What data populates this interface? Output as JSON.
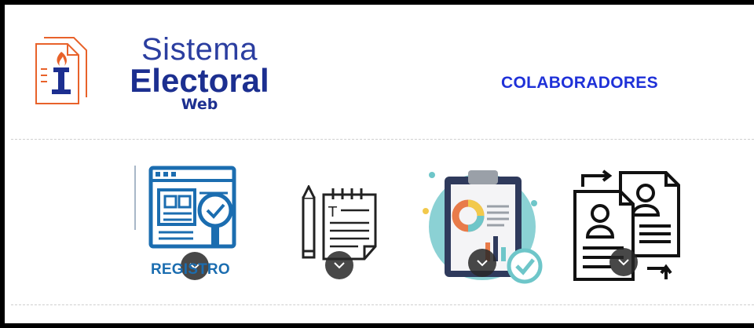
{
  "header": {
    "logo_line1": "Sistema",
    "logo_line2": "Electoral",
    "logo_line3": "Web",
    "logo_icon": "torch-document-icon",
    "nav_link": "COLABORADORES"
  },
  "cards": [
    {
      "id": "registro",
      "label": "REGISTRO",
      "icon": "registration-browser-icon"
    },
    {
      "id": "notes",
      "label": "",
      "icon": "notepad-pencil-icon"
    },
    {
      "id": "reports",
      "label": "",
      "icon": "clipboard-report-icon"
    },
    {
      "id": "profiles",
      "label": "",
      "icon": "profile-exchange-icon"
    }
  ],
  "colors": {
    "brand": "#1c2f90",
    "link": "#1f31d8",
    "registro": "#1b6db0",
    "logo_orange": "#e8622a",
    "teal": "#6ec6c9",
    "navy": "#2f3a5c"
  }
}
